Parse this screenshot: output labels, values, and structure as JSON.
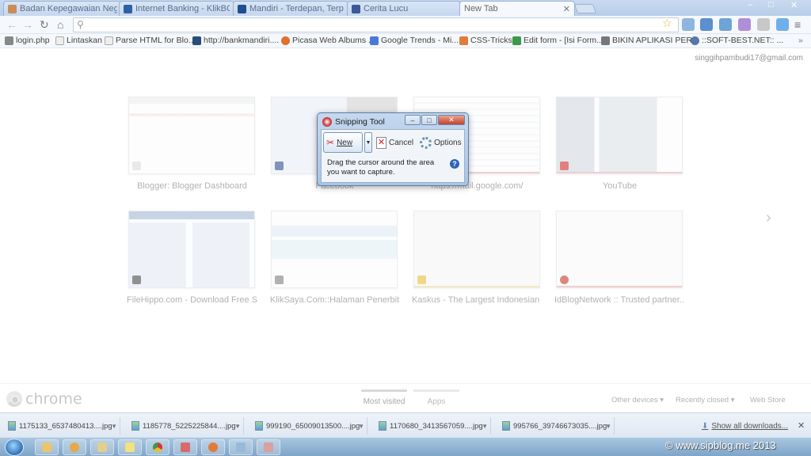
{
  "tabs": [
    {
      "label": "Badan Kepegawaian Nega",
      "color": "#c98c5a"
    },
    {
      "label": "Internet Banking - KlikBCA",
      "color": "#2f5fa5"
    },
    {
      "label": "Mandiri - Terdepan, Terpe",
      "color": "#1e4f8f"
    },
    {
      "label": "Cerita Lucu",
      "color": "#3b5998"
    },
    {
      "label": "New Tab",
      "color": "#ffffff"
    }
  ],
  "window_controls": {
    "minimize": "–",
    "maximize": "□",
    "close": "✕"
  },
  "toolbar": {
    "back": "←",
    "forward": "→",
    "reload": "↻",
    "home": "⌂",
    "search_icon": "🔍",
    "star": "☆",
    "menu": "≡"
  },
  "bookmarks": [
    {
      "label": "login.php",
      "color": "#888"
    },
    {
      "label": "Lintaskan",
      "color": "#ddd"
    },
    {
      "label": "Parse HTML for Blo...",
      "color": "#ddd"
    },
    {
      "label": "http://bankmandiri....",
      "color": "#2a4c7a"
    },
    {
      "label": "Picasa Web Albums ...",
      "color": "#e26f2b"
    },
    {
      "label": "Google Trends - Mi...",
      "color": "#4b7ad6"
    },
    {
      "label": "CSS-Tricks",
      "color": "#e07b3a"
    },
    {
      "label": "Edit form - [Isi Form...",
      "color": "#3a9a4a"
    },
    {
      "label": "BIKIN APLIKASI PER...",
      "color": "#777"
    },
    {
      "label": "::SOFT-BEST.NET:: ...",
      "color": "#5577aa"
    }
  ],
  "user_email": "singgihpambudi17@gmail.com",
  "most_visited": [
    {
      "caption": "Blogger: Blogger Dashboard",
      "badge": "#dddddd",
      "shot": "#f3d9c8"
    },
    {
      "caption": "Facebook",
      "badge": "#3b5998",
      "shot": "#dfe6f2"
    },
    {
      "caption": "https://mail.google.com/",
      "badge": "#dddddd",
      "shot": "#e8ecf1"
    },
    {
      "caption": "YouTube",
      "badge": "#d43b3b",
      "shot": "#d9dfe7"
    },
    {
      "caption": "FileHippo.com - Download Free S...",
      "badge": "#555555",
      "shot": "#d6e2ef"
    },
    {
      "caption": "KlikSaya.Com::Halaman Penerbit",
      "badge": "#888888",
      "shot": "#d6e9ef"
    },
    {
      "caption": "Kaskus - The Largest Indonesian ...",
      "badge": "#e8c24a",
      "shot": "#f4f4f4"
    },
    {
      "caption": "IdBlogNetwork :: Trusted partner...",
      "badge": "#c84a3a",
      "shot": "#f9f9f9"
    }
  ],
  "next_arrow": "›",
  "footer": {
    "logo_text": "chrome",
    "tab_most_visited": "Most visited",
    "tab_apps": "Apps",
    "other_devices": "Other devices ▾",
    "recently_closed": "Recently closed ▾",
    "web_store": "Web Store"
  },
  "downloads": [
    {
      "name": "1175133_6537480413....jpg"
    },
    {
      "name": "1185778_5225225844....jpg"
    },
    {
      "name": "999190_65009013500....jpg"
    },
    {
      "name": "1170680_3413567059....jpg"
    },
    {
      "name": "995766_39746673035....jpg"
    }
  ],
  "downloads_show_all": "Show all downloads...",
  "downloads_close": "✕",
  "snipping_tool": {
    "title": "Snipping Tool",
    "new_label": "New",
    "cancel_label": "Cancel",
    "options_label": "Options",
    "message": "Drag the cursor around the area you want to capture.",
    "help": "?"
  },
  "watermark": "© www.sipblog.me 2013"
}
